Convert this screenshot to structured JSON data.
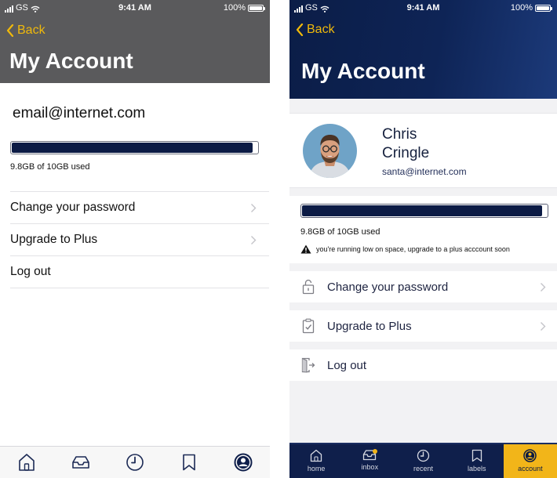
{
  "status_bar": {
    "carrier": "GS",
    "time": "9:41 AM",
    "battery": "100%"
  },
  "screen_a": {
    "back_label": "Back",
    "title": "My Account",
    "email": "email@internet.com",
    "storage": {
      "used_fraction": 0.98,
      "usage_text": "9.8GB of 10GB used"
    },
    "menu": [
      {
        "label": "Change your password",
        "chevron": true
      },
      {
        "label": "Upgrade to Plus",
        "chevron": true
      },
      {
        "label": "Log out",
        "chevron": false
      }
    ],
    "tabs": [
      "home-icon",
      "inbox-icon",
      "recent-icon",
      "labels-icon",
      "account-icon"
    ]
  },
  "screen_b": {
    "back_label": "Back",
    "title": "My Account",
    "profile": {
      "first_name": "Chris",
      "last_name": "Cringle",
      "email": "santa@internet.com"
    },
    "storage": {
      "used_fraction": 0.98,
      "usage_text": "9.8GB of 10GB used",
      "warning": "you're running low on space, upgrade to a plus acccount soon"
    },
    "menu": [
      {
        "label": "Change your password",
        "icon": "lock-icon",
        "chevron": true
      },
      {
        "label": "Upgrade to Plus",
        "icon": "upgrade-icon",
        "chevron": true
      },
      {
        "label": "Log out",
        "icon": "logout-icon",
        "chevron": false
      }
    ],
    "tabs": [
      {
        "label": "home",
        "icon": "home-icon"
      },
      {
        "label": "inbox",
        "icon": "inbox-icon",
        "badge": true
      },
      {
        "label": "recent",
        "icon": "recent-icon"
      },
      {
        "label": "labels",
        "icon": "labels-icon"
      },
      {
        "label": "account",
        "icon": "account-icon",
        "active": true
      }
    ]
  },
  "colors": {
    "accent": "#f0b90b",
    "navy": "#0c1b45",
    "header_gray": "#5a5a5c",
    "active_tab": "#f2b519"
  }
}
